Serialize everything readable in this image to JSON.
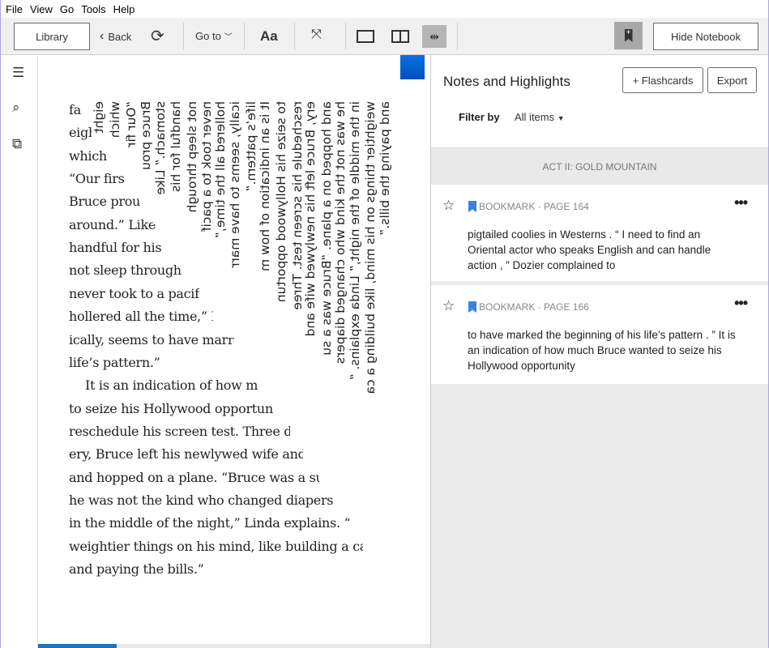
{
  "menu": [
    "File",
    "View",
    "Go",
    "Tools",
    "Help"
  ],
  "toolbar": {
    "library": "Library",
    "back": "Back",
    "goto": "Go to",
    "font": "Aa",
    "hide_notebook": "Hide Notebook"
  },
  "reader": {
    "lines": [
      "fa",
      "eigh",
      "which",
      "“Our firs",
      "Bruce prou",
      "around.” Like",
      "handful for his",
      "not sleep through",
      "never took to a pacif",
      "hollered all the time,” D",
      "ically, seems to have marr",
      "life’s pattern.”",
      "It is an indication of how m",
      "to seize his Hollywood opportun",
      "reschedule his screen test. Three da",
      "ery, Bruce left his newlywed wife and",
      "and hopped on a plane. “Bruce was a su",
      "he was not the kind who changed diapers",
      "in the middle of the night,” Linda explains. “",
      "weightier things on his mind, like building a ca",
      "and paying the bills.”"
    ],
    "overlay": [
      "eight",
      "which",
      "“Our fir",
      "Bruce prou",
      "stomach.” Like",
      "handful for his",
      "not sleep through",
      "never took to a pacif",
      "hollered all the time,”",
      "ically, seems to have marr",
      "life’s pattern.”",
      "It is an indication of how m",
      "to seize his Hollywood opportun",
      "reschedule his screen test. Three",
      "ery, Bruce left his newlywed wife and",
      "and hopped on a plane. “Bruce was a su",
      "he was not the kind who changed diapers",
      "in the middle of the night,” Linda explains. “",
      "weightier things on his mind, like building a ca",
      "and paying the bills.”"
    ],
    "progress_percent": 20
  },
  "notebook": {
    "title": "Notes and Highlights",
    "flashcards": "+ Flashcards",
    "export": "Export",
    "filter_label": "Filter by",
    "filter_value": "All items",
    "section": "ACT II: GOLD MOUNTAIN",
    "items": [
      {
        "type": "BOOKMARK · PAGE 164",
        "text": "pigtailed coolies in Westerns . “ I need to find an Oriental actor who speaks English and can handle action , ” Dozier complained to"
      },
      {
        "type": "BOOKMARK · PAGE 166",
        "text": "to have marked the beginning of his life’s pattern . ” It is an indication of how much Bruce wanted to seize his Hollywood opportunity"
      }
    ]
  },
  "colors": {
    "accent": "#1a73c8",
    "bookmark": "#3b82e6"
  }
}
